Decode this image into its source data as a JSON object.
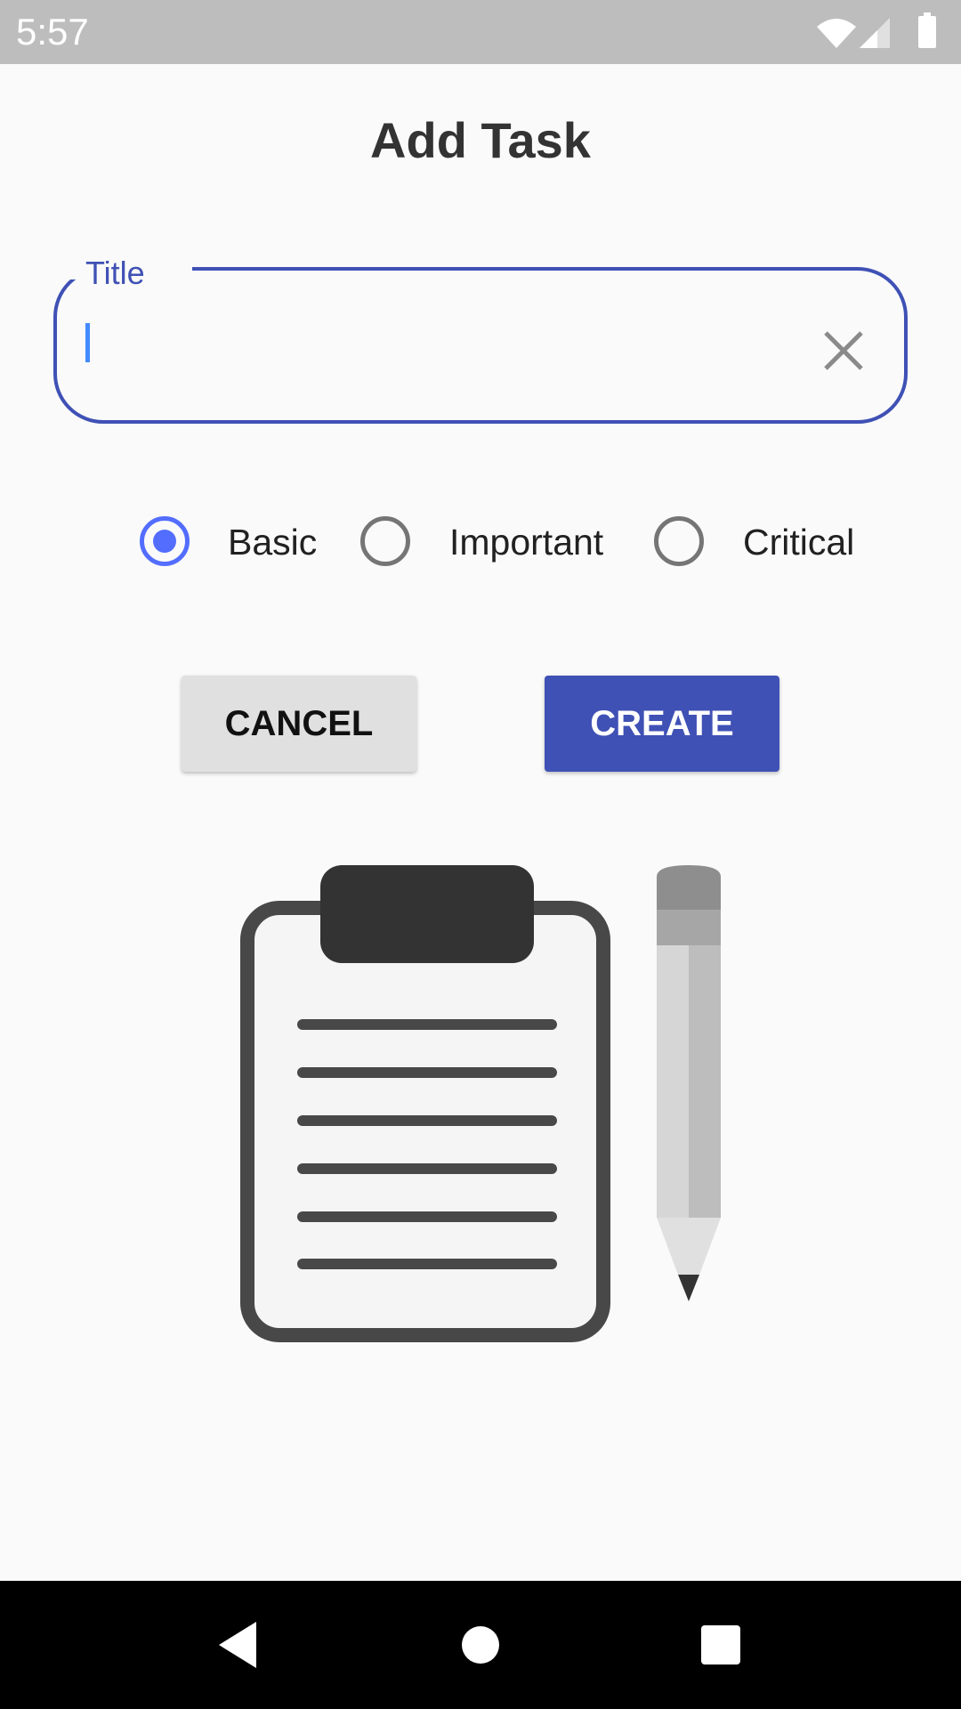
{
  "status_bar": {
    "time": "5:57",
    "icons": [
      "wifi-icon",
      "signal-icon",
      "battery-icon"
    ],
    "background": "#bdbdbd"
  },
  "dialog": {
    "title": "Add Task",
    "title_field": {
      "label": "Title",
      "value": "",
      "clear_icon": "close-icon"
    },
    "priority": {
      "selected": "Basic",
      "options": [
        {
          "label": "Basic",
          "checked": true
        },
        {
          "label": "Important",
          "checked": false
        },
        {
          "label": "Critical",
          "checked": false
        }
      ]
    },
    "cancel_label": "CANCEL",
    "create_label": "CREATE",
    "illustration": [
      "clipboard-icon",
      "pencil-icon"
    ]
  },
  "colors": {
    "accent": "#3f51b5",
    "radio_checked": "#536dfe",
    "background": "#fafafa"
  },
  "nav_bar": {
    "buttons": [
      "back-icon",
      "home-icon",
      "recents-icon"
    ]
  }
}
